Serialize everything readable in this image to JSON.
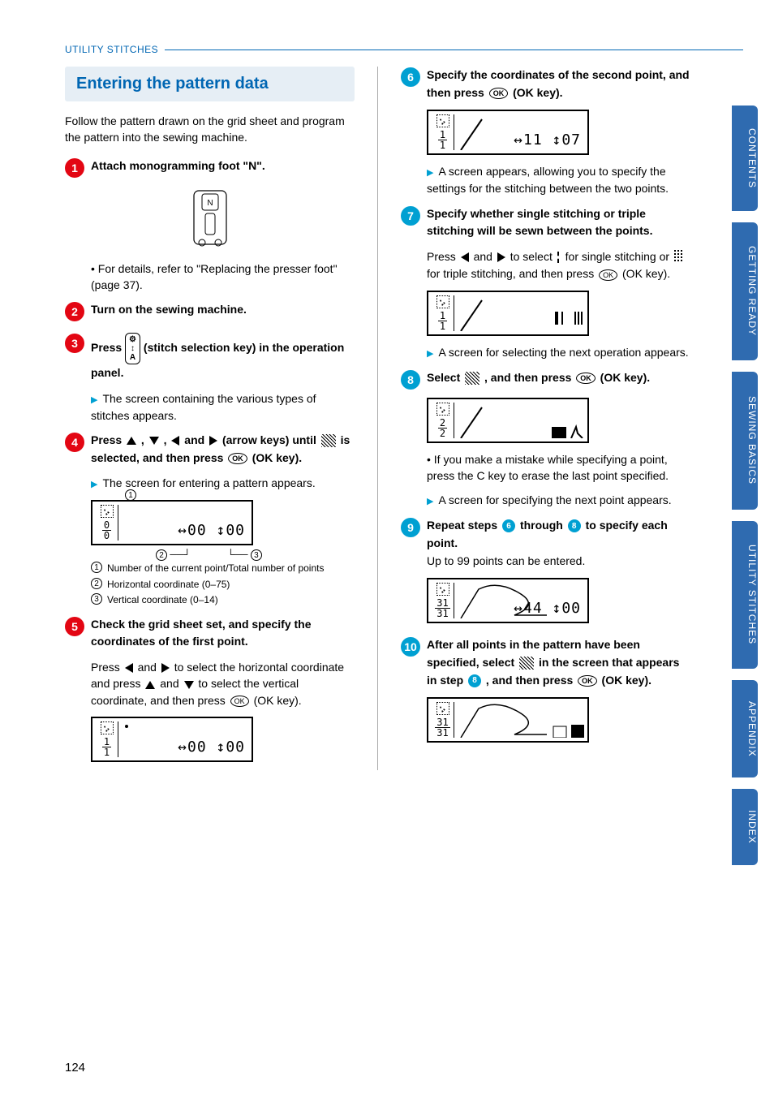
{
  "header": {
    "breadcrumb": "UTILITY STITCHES"
  },
  "section_title": "Entering the pattern data",
  "intro": "Follow the pattern drawn on the grid sheet and program the pattern into the sewing machine.",
  "page_number": "124",
  "tabs": [
    "CONTENTS",
    "GETTING READY",
    "SEWING BASICS",
    "UTILITY STITCHES",
    "APPENDIX",
    "INDEX"
  ],
  "steps": {
    "s1": {
      "lead": "Attach monogramming foot \"N\".",
      "detail": "For details, refer to \"Replacing the presser foot\" (page 37)."
    },
    "s2": {
      "lead": "Turn on the sewing machine."
    },
    "s3": {
      "lead_pre": "Press ",
      "lead_mid": " (stitch selection key) in the operation panel.",
      "result": "The screen containing the various types of stitches appears."
    },
    "s4": {
      "lead_pre": "Press ",
      "lead_mid": " (arrow keys) until ",
      "lead_post": " is selected, and then press ",
      "lead_end": " (OK key).",
      "result": "The screen for entering a pattern appears."
    },
    "callouts": {
      "c1": "Number of the current point/Total number of points",
      "c2": "Horizontal coordinate (0–75)",
      "c3": "Vertical coordinate (0–14)"
    },
    "s5": {
      "lead": "Check the grid sheet set, and specify the coordinates of the first point.",
      "body_pre": "Press ",
      "body_mid1": " to select the horizontal coordinate and press ",
      "body_mid2": " to select the vertical coordinate, and then press ",
      "body_end": " (OK key)."
    },
    "s6": {
      "lead_pre": "Specify the coordinates of the second point, and then press ",
      "lead_end": " (OK key).",
      "result": "A screen appears, allowing you to specify the settings for the stitching between the two points."
    },
    "s7": {
      "lead": "Specify whether single stitching or triple stitching will be sewn between the points.",
      "body_pre": "Press ",
      "body_mid1": " to select ",
      "body_mid2": " for single stitching or ",
      "body_mid3": " for triple stitching, and then press ",
      "body_end": " (OK key).",
      "result": "A screen for selecting the next operation appears."
    },
    "s8": {
      "lead_pre": "Select ",
      "lead_mid": " , and then press ",
      "lead_end": " (OK key).",
      "bullet": "If you make a mistake while specifying a point, press the C key to erase the last point specified.",
      "result": "A screen for specifying the next point appears."
    },
    "s9": {
      "lead_pre": "Repeat steps ",
      "lead_mid": " through ",
      "lead_post": " to specify each point.",
      "body": "Up to 99 points can be entered."
    },
    "s10": {
      "lead_pre": "After all points in the pattern have been specified, select ",
      "lead_mid": " in the screen that appears in step ",
      "lead_post": ", and then press ",
      "lead_end": " (OK key)."
    }
  },
  "lcd": {
    "frac_0_0": {
      "top": "0",
      "bot": "0"
    },
    "frac_1_1": {
      "top": "1",
      "bot": "1"
    },
    "frac_2_2": {
      "top": "2",
      "bot": "2"
    },
    "frac_31_31": {
      "top": "31",
      "bot": "31"
    },
    "coord_00_00": "↔00 ↕00",
    "coord_11_07": "↔11 ↕07",
    "coord_44_00": "↔44 ↕00"
  },
  "ok_label": "OK",
  "and_word": " and ",
  "comma": " , "
}
